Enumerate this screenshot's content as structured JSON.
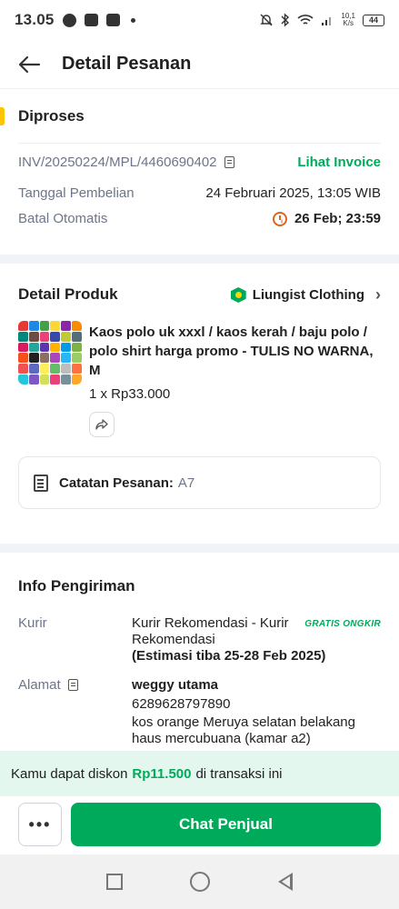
{
  "status_bar": {
    "time": "13.05",
    "speed_top": "10,1",
    "speed_unit": "K/s",
    "battery": "44"
  },
  "header": {
    "title": "Detail Pesanan"
  },
  "order": {
    "status": "Diproses",
    "invoice": "INV/20250224/MPL/4460690402",
    "invoice_link": "Lihat Invoice",
    "purchase_date_label": "Tanggal Pembelian",
    "purchase_date": "24 Februari 2025, 13:05 WIB",
    "auto_cancel_label": "Batal Otomatis",
    "auto_cancel": "26 Feb; 23:59"
  },
  "product_section": {
    "title": "Detail Produk",
    "shop_name": "Liungist Clothing",
    "product_name": "Kaos polo uk xxxl / kaos kerah / baju polo / polo shirt harga promo - TULIS NO WARNA, M",
    "quantity_price": "1 x Rp33.000",
    "note_label": "Catatan Pesanan:",
    "note_value": "A7"
  },
  "shipping": {
    "title": "Info Pengiriman",
    "courier_label": "Kurir",
    "courier_value": "Kurir Rekomendasi - Kurir Rekomendasi",
    "estimate": "(Estimasi tiba 25-28 Feb 2025)",
    "free_shipping": "GRATIS ONGKIR",
    "address_label": "Alamat",
    "recipient": "weggy utama",
    "phone": "6289628797890",
    "address": "kos orange Meruya selatan belakang haus mercubuana (kamar a2)"
  },
  "discount": {
    "prefix": "Kamu dapat diskon",
    "amount": "Rp11.500",
    "suffix": "di transaksi ini"
  },
  "actions": {
    "more": "•••",
    "chat": "Chat Penjual"
  },
  "colors": {
    "accent": "#00aa5b",
    "warning": "#e0641a",
    "status": "#ffc400"
  }
}
